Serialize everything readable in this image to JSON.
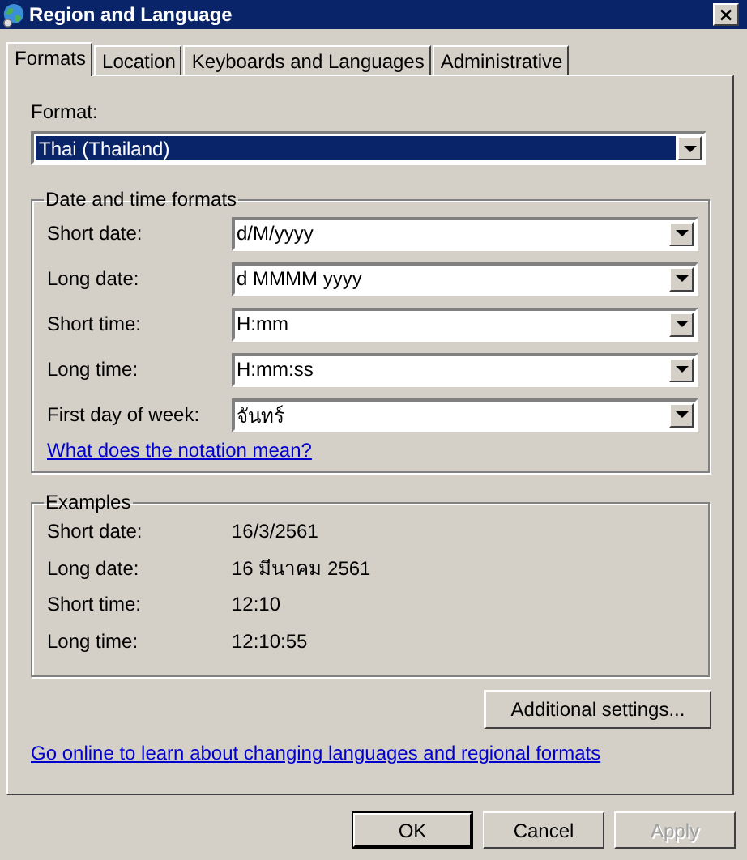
{
  "window": {
    "title": "Region and Language",
    "close": "×"
  },
  "tabs": [
    {
      "label": "Formats",
      "selected": true
    },
    {
      "label": "Location",
      "selected": false
    },
    {
      "label": "Keyboards and Languages",
      "selected": false
    },
    {
      "label": "Administrative",
      "selected": false
    }
  ],
  "format": {
    "label": "Format:",
    "value": "Thai (Thailand)"
  },
  "date_time_formats": {
    "title": "Date and time formats",
    "rows": [
      {
        "label": "Short date:",
        "value": "d/M/yyyy"
      },
      {
        "label": "Long date:",
        "value": "d MMMM yyyy"
      },
      {
        "label": "Short time:",
        "value": "H:mm"
      },
      {
        "label": "Long time:",
        "value": "H:mm:ss"
      },
      {
        "label": "First day of week:",
        "value": "จันทร์"
      }
    ],
    "link": "What does the notation mean?"
  },
  "examples": {
    "title": "Examples",
    "rows": [
      {
        "label": "Short date:",
        "value": "16/3/2561"
      },
      {
        "label": "Long date:",
        "value": "16 มีนาคม 2561"
      },
      {
        "label": "Short time:",
        "value": "12:10"
      },
      {
        "label": "Long time:",
        "value": "12:10:55"
      }
    ]
  },
  "additional_settings": "Additional settings...",
  "online_link": "Go online to learn about changing languages and regional formats",
  "buttons": [
    {
      "label": "OK",
      "default": true,
      "disabled": false
    },
    {
      "label": "Cancel",
      "default": false,
      "disabled": false
    },
    {
      "label": "Apply",
      "default": false,
      "disabled": true
    }
  ]
}
